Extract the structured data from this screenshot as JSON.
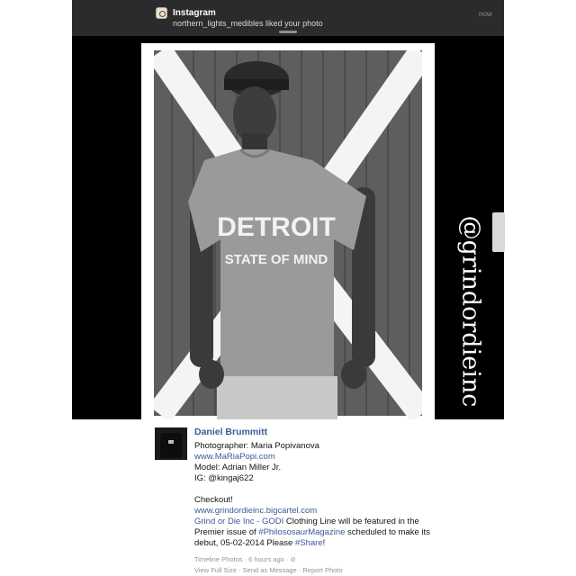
{
  "notification": {
    "app": "Instagram",
    "message": "northern_lights_medibles liked your photo",
    "time": "now"
  },
  "photo": {
    "shirt_line1": "DETROIT",
    "shirt_line2": "STATE OF MIND",
    "watermark": "@grindordieinc"
  },
  "post": {
    "author": "Daniel Brummitt",
    "line_photographer": "Photographer: Maria Popivanova",
    "link_website": "www.MaRiaPopi.com",
    "line_model": "Model: Adrian Miller Jr.",
    "line_ig": "IG: @kingaj622",
    "line_checkout": "Checkout!",
    "link_store": "www.grindordieinc.bigcartel.com",
    "link_brand": "Grind or Die Inc - GODI",
    "text_featured": " Clothing Line will be featured in the",
    "text_premier": "Premier issue of ",
    "hashtag_magazine": "#PhilososaurMagazine",
    "text_scheduled": " scheduled to make its",
    "text_debut": "debut, 05-02-2014 Please ",
    "hashtag_share": "#Share",
    "text_exclaim": "!",
    "meta_source": "Timeline Photos",
    "meta_time": "6 hours ago",
    "action_full_size": "View Full Size",
    "action_send": "Send as Message",
    "action_report": "Report Photo"
  },
  "colors": {
    "link": "#3b5998",
    "notification_bg": "#2b2b2d",
    "meta": "#90949c"
  }
}
